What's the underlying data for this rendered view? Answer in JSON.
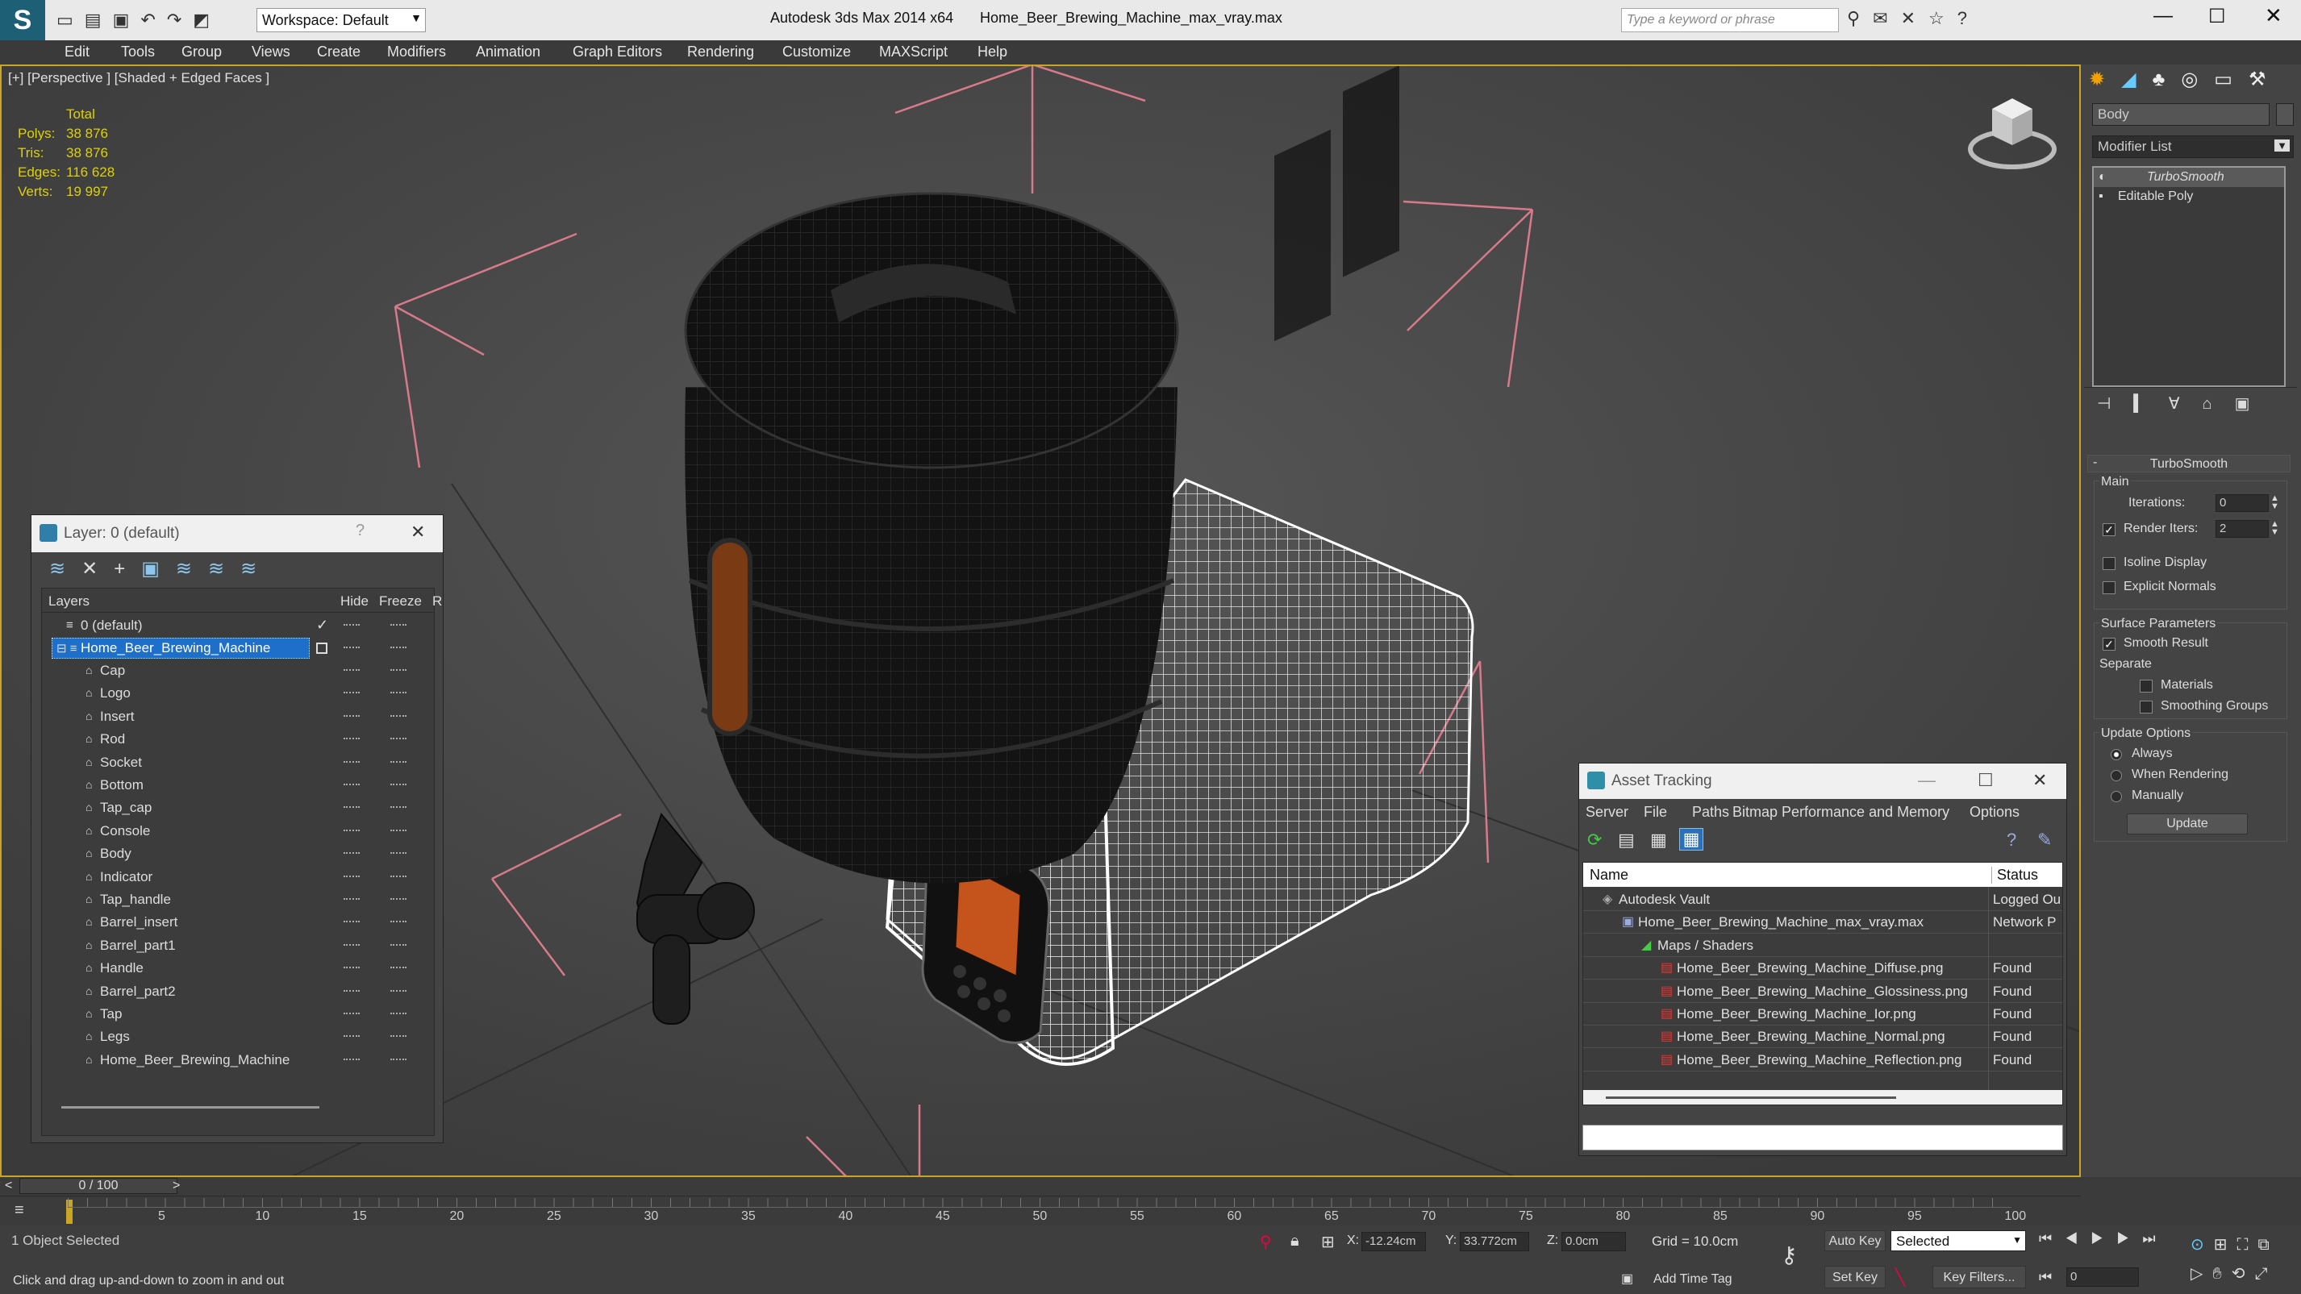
{
  "titlebar": {
    "workspace": "Workspace: Default",
    "app": "Autodesk 3ds Max  2014 x64",
    "file": "Home_Beer_Brewing_Machine_max_vray.max",
    "search_placeholder": "Type a keyword or phrase"
  },
  "menu": [
    "Edit",
    "Tools",
    "Group",
    "Views",
    "Create",
    "Modifiers",
    "Animation",
    "Graph Editors",
    "Rendering",
    "Customize",
    "MAXScript",
    "Help"
  ],
  "viewport": {
    "label": "[+] [Perspective ] [Shaded + Edged Faces ]",
    "stats": {
      "total_label": "Total",
      "rows": [
        {
          "k": "Polys:",
          "v": "38 876"
        },
        {
          "k": "Tris:",
          "v": "38 876"
        },
        {
          "k": "Edges:",
          "v": "116 628"
        },
        {
          "k": "Verts:",
          "v": "19 997"
        }
      ]
    }
  },
  "layer_dialog": {
    "title": "Layer: 0 (default)",
    "help": "?",
    "columns": {
      "layers": "Layers",
      "hide": "Hide",
      "freeze": "Freeze",
      "r": "R"
    },
    "layers": [
      {
        "name": "0 (default)",
        "check": "✓"
      },
      {
        "name": "Home_Beer_Brewing_Machine",
        "selected": true
      }
    ],
    "objects": [
      "Cap",
      "Logo",
      "Insert",
      "Rod",
      "Socket",
      "Bottom",
      "Tap_cap",
      "Console",
      "Body",
      "Indicator",
      "Tap_handle",
      "Barrel_insert",
      "Barrel_part1",
      "Handle",
      "Barrel_part2",
      "Tap",
      "Legs",
      "Home_Beer_Brewing_Machine"
    ]
  },
  "asset_tracking": {
    "title": "Asset Tracking",
    "menu": [
      "Server",
      "File",
      "Paths",
      "Bitmap Performance and Memory",
      "Options"
    ],
    "columns": {
      "name": "Name",
      "status": "Status"
    },
    "rows": [
      {
        "name": "Autodesk Vault",
        "status": "Logged Ou",
        "indent": 1
      },
      {
        "name": "Home_Beer_Brewing_Machine_max_vray.max",
        "status": "Network P",
        "indent": 2
      },
      {
        "name": "Maps / Shaders",
        "status": "",
        "indent": 3
      },
      {
        "name": "Home_Beer_Brewing_Machine_Diffuse.png",
        "status": "Found",
        "indent": 4
      },
      {
        "name": "Home_Beer_Brewing_Machine_Glossiness.png",
        "status": "Found",
        "indent": 4
      },
      {
        "name": "Home_Beer_Brewing_Machine_Ior.png",
        "status": "Found",
        "indent": 4
      },
      {
        "name": "Home_Beer_Brewing_Machine_Normal.png",
        "status": "Found",
        "indent": 4
      },
      {
        "name": "Home_Beer_Brewing_Machine_Reflection.png",
        "status": "Found",
        "indent": 4
      }
    ]
  },
  "command_panel": {
    "object_name": "Body",
    "modifier_list": "Modifier List",
    "stack": [
      "TurboSmooth",
      "Editable Poly"
    ],
    "rollout_title": "TurboSmooth",
    "main_label": "Main",
    "iterations_label": "Iterations:",
    "iterations_value": "0",
    "render_iters_label": "Render Iters:",
    "render_iters_value": "2",
    "isoline": "Isoline Display",
    "explicit_normals": "Explicit Normals",
    "surface_params": "Surface Parameters",
    "smooth_result": "Smooth Result",
    "separate": "Separate",
    "materials": "Materials",
    "smoothing_groups": "Smoothing Groups",
    "update_options": "Update Options",
    "always": "Always",
    "when_rendering": "When Rendering",
    "manually": "Manually",
    "update_button": "Update"
  },
  "timeline": {
    "frame": "0 / 100",
    "ticks": [
      "5",
      "10",
      "15",
      "20",
      "25",
      "30",
      "35",
      "40",
      "45",
      "50",
      "55",
      "60",
      "65",
      "70",
      "75",
      "80",
      "85",
      "90",
      "95",
      "100"
    ]
  },
  "status": {
    "selected": "1 Object Selected",
    "hint": "Click and drag up-and-down to zoom in and out",
    "x_label": "X:",
    "x": "-12.24cm",
    "y_label": "Y:",
    "y": "33.772cm",
    "z_label": "Z:",
    "z": "0.0cm",
    "grid": "Grid = 10.0cm",
    "add_time_tag": "Add Time Tag",
    "auto_key": "Auto Key",
    "set_key": "Set Key",
    "selected_dropdown": "Selected",
    "key_filters": "Key Filters...",
    "frame_field": "0"
  }
}
